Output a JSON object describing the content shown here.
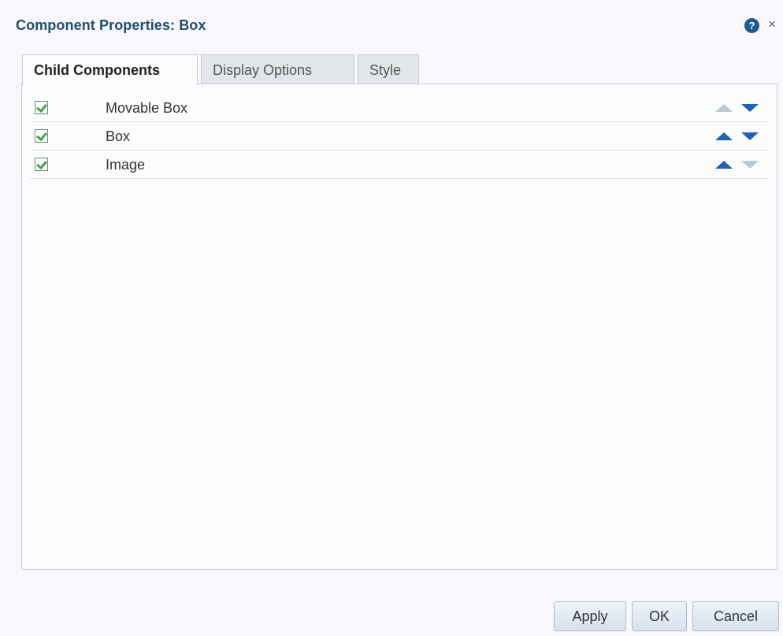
{
  "dialog": {
    "title": "Component Properties: Box",
    "help_icon": "help-icon",
    "close_icon": "close-icon",
    "close_glyph": "×",
    "help_glyph": "?"
  },
  "tabs": [
    {
      "label": "Child Components",
      "active": true
    },
    {
      "label": "Display Options",
      "active": false
    },
    {
      "label": "Style",
      "active": false
    }
  ],
  "child_components": [
    {
      "label": "Movable Box",
      "checked": true,
      "move_up_enabled": false,
      "move_down_enabled": true
    },
    {
      "label": "Box",
      "checked": true,
      "move_up_enabled": true,
      "move_down_enabled": true
    },
    {
      "label": "Image",
      "checked": true,
      "move_up_enabled": true,
      "move_down_enabled": false
    }
  ],
  "buttons": {
    "apply": "Apply",
    "ok": "OK",
    "cancel": "Cancel"
  },
  "colors": {
    "title": "#1e4f6f",
    "arrow_enabled": "#1c63b7",
    "arrow_disabled": "#b8c9da",
    "checkmark": "#3ca83a"
  }
}
